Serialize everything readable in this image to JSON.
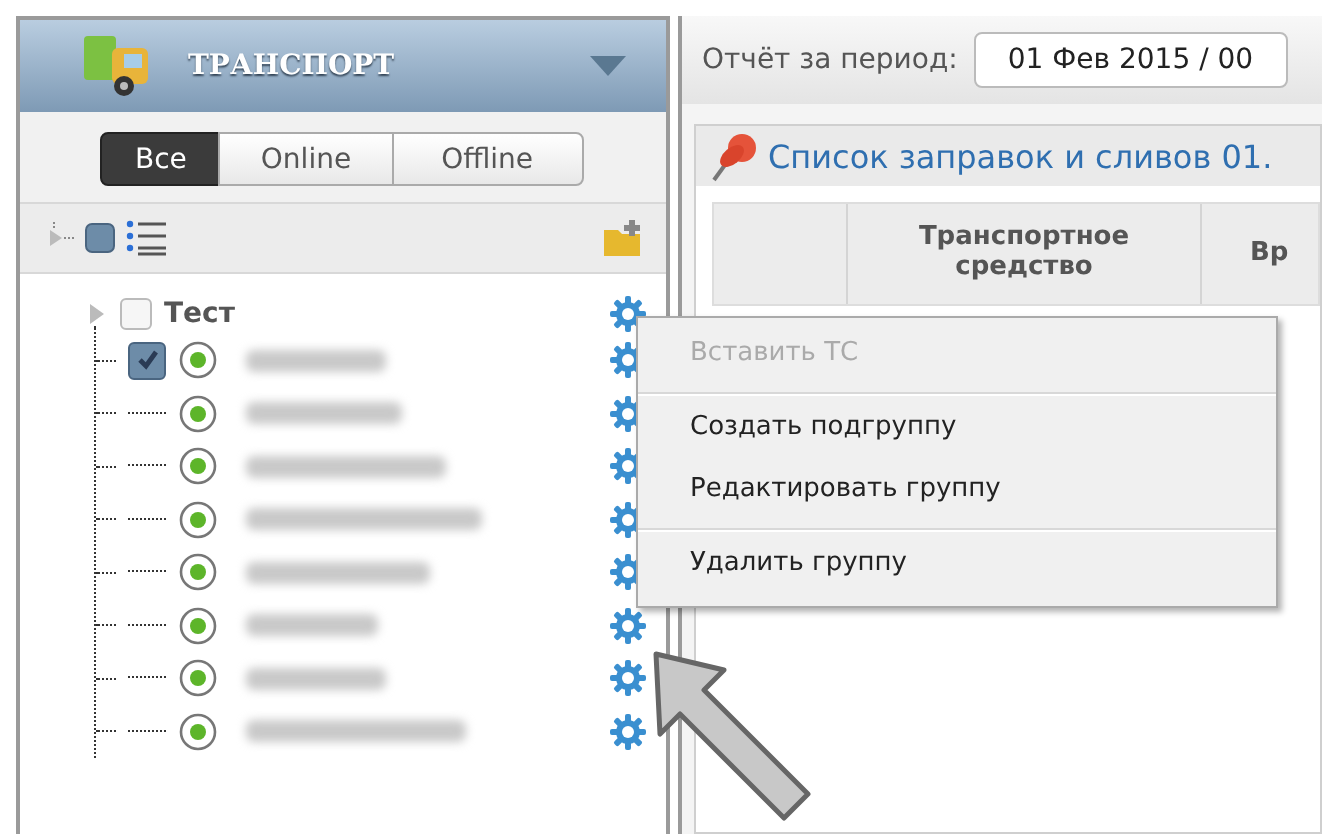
{
  "sidebar": {
    "title": "ТРАНСПОРТ",
    "filters": [
      {
        "label": "Все",
        "selected": true
      },
      {
        "label": "Online",
        "selected": false
      },
      {
        "label": "Offline",
        "selected": false
      }
    ],
    "tree": [
      {
        "label": "Тест",
        "checked": false,
        "children": [
          {
            "checked": true,
            "online": true
          },
          {
            "checked": false,
            "online": true
          },
          {
            "checked": false,
            "online": true
          },
          {
            "checked": false,
            "online": true
          },
          {
            "checked": false,
            "online": true
          },
          {
            "checked": false,
            "online": true
          },
          {
            "checked": false,
            "online": true
          },
          {
            "checked": false,
            "online": true
          }
        ]
      }
    ]
  },
  "report": {
    "period_label": "Отчёт за период:",
    "period_value": "01 Фев 2015 / 00",
    "panel_title": "Список заправок и сливов 01.",
    "table": {
      "columns": [
        "",
        "Транспортное средство",
        "Вр"
      ]
    }
  },
  "context_menu": [
    {
      "label": "Вставить ТС",
      "disabled": true,
      "separator_after": true
    },
    {
      "label": "Создать подгруппу",
      "disabled": false,
      "separator_after": false
    },
    {
      "label": "Редактировать группу",
      "disabled": false,
      "separator_after": true
    },
    {
      "label": "Удалить группу",
      "disabled": false,
      "separator_after": false
    }
  ]
}
